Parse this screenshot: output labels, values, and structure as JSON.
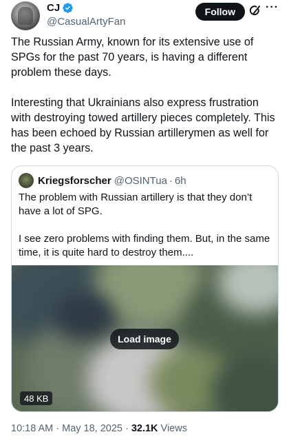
{
  "author": {
    "display_name": "CJ",
    "handle": "@CasualArtyFan"
  },
  "actions": {
    "follow_label": "Follow"
  },
  "tweet": {
    "paragraphs": [
      "The Russian Army, known for its extensive use of SPGs for the past 70 years, is having a different problem these days.",
      "Interesting that Ukrainians also express frustration with destroying towed artillery pieces completely. This has been echoed by Russian artillerymen as well for the past 3 years."
    ]
  },
  "quote": {
    "display_name": "Kriegsforscher",
    "handle": "@OSINTua",
    "dot": "·",
    "time": "6h",
    "paragraphs": [
      "The problem with Russian artillery is that they don’t have a lot of SPG.",
      "I see zero problems with finding them. But, in the same time, it is quite hard to destroy them...."
    ],
    "media": {
      "load_label": "Load image",
      "size_label": "48 KB"
    }
  },
  "meta": {
    "time": "10:18 AM",
    "sep": "·",
    "date": "May 18, 2025",
    "views_count": "32.1K",
    "views_label": "Views"
  },
  "colors": {
    "text": "#0f1419",
    "secondary": "#536471",
    "verified": "#1d9bf0",
    "border": "#cfd9de"
  },
  "icons": [
    "verified-badge-icon",
    "grok-icon",
    "more-icon"
  ]
}
